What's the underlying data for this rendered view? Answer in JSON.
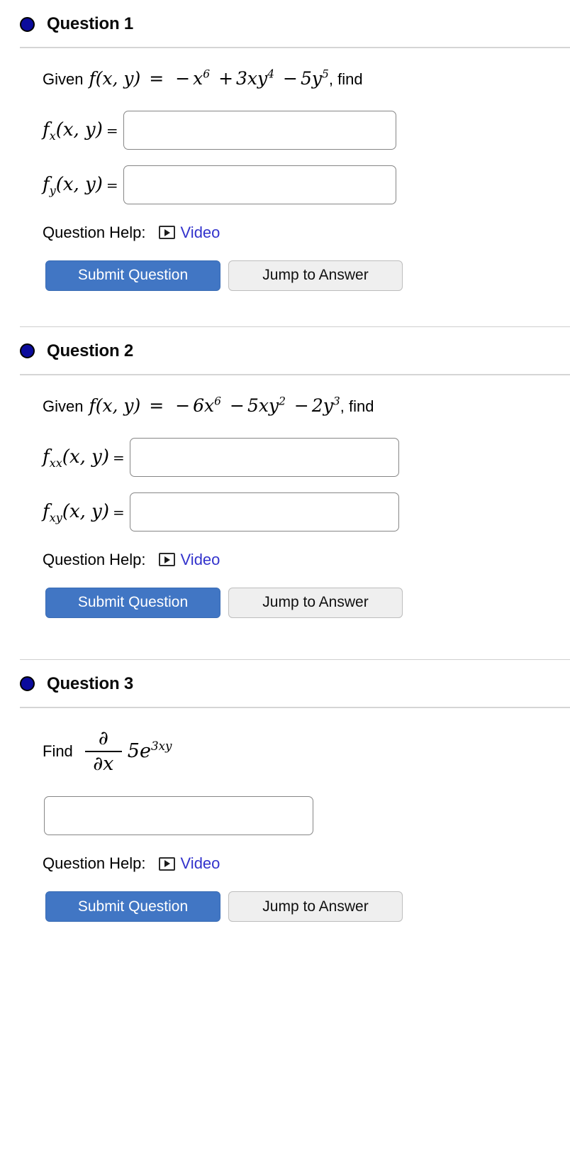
{
  "questions": [
    {
      "title": "Question 1",
      "bullet_color": "#0b0b9c",
      "prompt_lead": "Given",
      "prompt_func": "f(x, y)",
      "prompt_eq": "=",
      "prompt_expr_parts": [
        {
          "op": "−",
          "term": "x",
          "exp": "6"
        },
        {
          "op": "+",
          "term": "3xy",
          "exp": "4"
        },
        {
          "op": "−",
          "term": "5y",
          "exp": "5"
        }
      ],
      "prompt_plain": "Given f(x, y) = − x^6 + 3xy^4 − 5y^5, find",
      "prompt_tail": ", find",
      "answers": [
        {
          "label_base": "f",
          "label_sub": "x",
          "label_args": "(x, y)",
          "eq": "=",
          "value": "",
          "placeholder": ""
        },
        {
          "label_base": "f",
          "label_sub": "y",
          "label_args": "(x, y)",
          "eq": "=",
          "value": "",
          "placeholder": ""
        }
      ],
      "help_label": "Question Help:",
      "video_label": "Video",
      "video_icon": "video-play-icon",
      "submit_label": "Submit Question",
      "jump_label": "Jump to Answer"
    },
    {
      "title": "Question 2",
      "bullet_color": "#0b0b9c",
      "prompt_lead": "Given",
      "prompt_func": "f(x, y)",
      "prompt_eq": "=",
      "prompt_expr_parts": [
        {
          "op": "−",
          "term": "6x",
          "exp": "6"
        },
        {
          "op": "−",
          "term": "5xy",
          "exp": "2"
        },
        {
          "op": "−",
          "term": "2y",
          "exp": "3"
        }
      ],
      "prompt_plain": "Given f(x, y) = − 6x^6 − 5xy^2 − 2y^3, find",
      "prompt_tail": ", find",
      "answers": [
        {
          "label_base": "f",
          "label_sub": "xx",
          "label_args": "(x, y)",
          "eq": "=",
          "value": "",
          "placeholder": ""
        },
        {
          "label_base": "f",
          "label_sub": "xy",
          "label_args": "(x, y)",
          "eq": "=",
          "value": "",
          "placeholder": ""
        }
      ],
      "help_label": "Question Help:",
      "video_label": "Video",
      "video_icon": "video-play-icon",
      "submit_label": "Submit Question",
      "jump_label": "Jump to Answer"
    },
    {
      "title": "Question 3",
      "bullet_color": "#0b0b9c",
      "prompt_lead": "Find",
      "derivative": {
        "numerator": "∂",
        "denominator": "∂x",
        "expression_base": "5e",
        "expression_exp": "3xy"
      },
      "prompt_plain": "Find ∂/∂x 5e^(3xy)",
      "answers": [
        {
          "label_base": "",
          "label_sub": "",
          "label_args": "",
          "eq": "",
          "value": "",
          "placeholder": ""
        }
      ],
      "help_label": "Question Help:",
      "video_label": "Video",
      "video_icon": "video-play-icon",
      "submit_label": "Submit Question",
      "jump_label": "Jump to Answer"
    }
  ],
  "colors": {
    "bullet": "#0b0b9c",
    "link": "#3333cc",
    "primary_button": "#4176c4",
    "secondary_button": "#efefef",
    "divider": "#cfcfcf",
    "input_border": "#868686"
  }
}
